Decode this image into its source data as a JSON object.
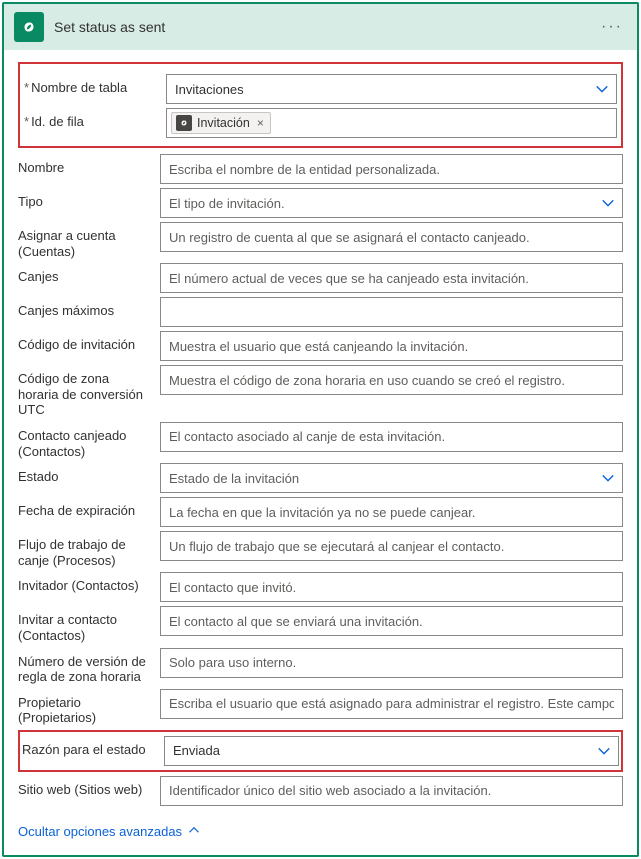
{
  "header": {
    "title": "Set status as sent"
  },
  "required_group": {
    "tableName": {
      "label": "Nombre de tabla",
      "value": "Invitaciones"
    },
    "rowId": {
      "label": "Id. de fila",
      "tokenLabel": "Invitación"
    }
  },
  "fields": {
    "nombre": {
      "label": "Nombre",
      "placeholder": "Escriba el nombre de la entidad personalizada."
    },
    "tipo": {
      "label": "Tipo",
      "placeholder": "El tipo de invitación."
    },
    "asignarCuenta": {
      "label": "Asignar a cuenta (Cuentas)",
      "placeholder": "Un registro de cuenta al que se asignará el contacto canjeado."
    },
    "canjes": {
      "label": "Canjes",
      "placeholder": "El número actual de veces que se ha canjeado esta invitación."
    },
    "canjesMax": {
      "label": "Canjes máximos",
      "placeholder": ""
    },
    "codigoInv": {
      "label": "Código de invitación",
      "placeholder": "Muestra el usuario que está canjeando la invitación."
    },
    "codigoZona": {
      "label": "Código de zona horaria de conversión UTC",
      "placeholder": "Muestra el código de zona horaria en uso cuando se creó el registro."
    },
    "contactoCan": {
      "label": "Contacto canjeado (Contactos)",
      "placeholder": "El contacto asociado al canje de esta invitación."
    },
    "estado": {
      "label": "Estado",
      "placeholder": "Estado de la invitación"
    },
    "fechaExp": {
      "label": "Fecha de expiración",
      "placeholder": "La fecha en que la invitación ya no se puede canjear."
    },
    "flujoTrab": {
      "label": "Flujo de trabajo de canje (Procesos)",
      "placeholder": "Un flujo de trabajo que se ejecutará al canjear el contacto."
    },
    "invitador": {
      "label": "Invitador (Contactos)",
      "placeholder": "El contacto que invitó."
    },
    "invitarCont": {
      "label": "Invitar a contacto (Contactos)",
      "placeholder": "El contacto al que se enviará una invitación."
    },
    "numVersion": {
      "label": "Número de versión de regla de zona horaria",
      "placeholder": "Solo para uso interno."
    },
    "propietario": {
      "label": "Propietario (Propietarios)",
      "placeholder": "Escriba el usuario que está asignado para administrar el registro. Este campo se"
    }
  },
  "statusReason": {
    "label": "Razón para el estado",
    "value": "Enviada"
  },
  "sitioWeb": {
    "label": "Sitio web (Sitios web)",
    "placeholder": "Identificador único del sitio web asociado a la invitación."
  },
  "advancedToggle": "Ocultar opciones avanzadas"
}
